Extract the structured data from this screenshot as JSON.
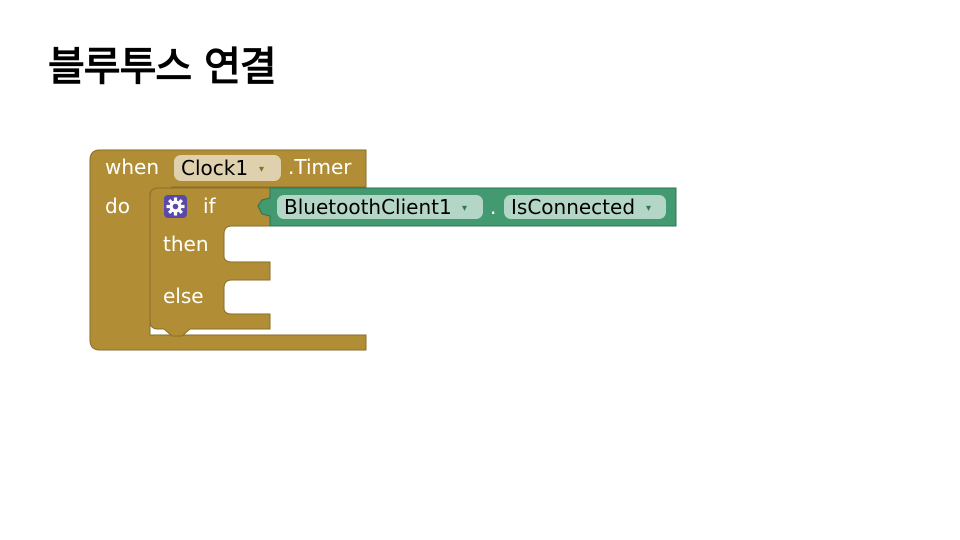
{
  "slide": {
    "title": "블루투스 연결"
  },
  "event_block": {
    "when_label": "when",
    "component": "Clock1",
    "event": ".Timer",
    "do_label": "do"
  },
  "if_block": {
    "if_label": "if",
    "then_label": "then",
    "else_label": "else",
    "mutator_icon": "gear-icon"
  },
  "condition_block": {
    "component": "BluetoothClient1",
    "dot": ".",
    "property": "IsConnected"
  },
  "dropdown_arrow": "▾",
  "colors": {
    "event_block": "#B18E35",
    "event_block_dark": "#8A6E29",
    "property_block": "#439970",
    "property_block_dark": "#2F7553",
    "event_field": "#E0D1AE",
    "property_field": "#B4D6C6",
    "mutator": "#5A4AA8"
  }
}
